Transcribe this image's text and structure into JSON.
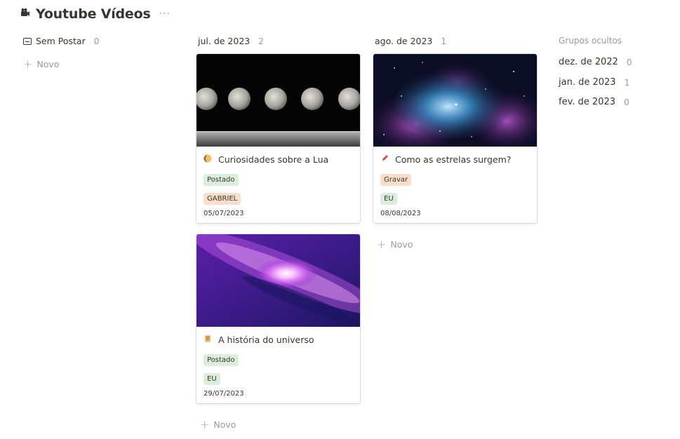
{
  "page": {
    "title": "Youtube Vídeos",
    "icon": "movie-camera-icon",
    "more": "···"
  },
  "columns": [
    {
      "label": "Sem Postar",
      "count": "0",
      "new_label": "Novo"
    },
    {
      "label": "jul. de 2023",
      "count": "2",
      "new_label": "Novo"
    },
    {
      "label": "ago. de 2023",
      "count": "1",
      "new_label": "Novo"
    }
  ],
  "cards": [
    {
      "title": "Curiosidades sobre a Lua",
      "emoji": "moon-icon",
      "status": "Postado",
      "status_color": "#dbeddb",
      "owner": "GABRIEL",
      "owner_color": "#fadec9",
      "date": "05/07/2023"
    },
    {
      "title": "A história do universo",
      "emoji": "scroll-icon",
      "status": "Postado",
      "status_color": "#dbeddb",
      "owner": "EU",
      "owner_color": "#dbeddb",
      "date": "29/07/2023"
    },
    {
      "title": "Como as estrelas surgem?",
      "emoji": "crayon-icon",
      "status": "Gravar",
      "status_color": "#fadec9",
      "owner": "EU",
      "owner_color": "#dbeddb",
      "date": "08/08/2023"
    }
  ],
  "hidden": {
    "label": "Grupos ocultos",
    "groups": [
      {
        "label": "dez. de 2022",
        "count": "0"
      },
      {
        "label": "jan. de 2023",
        "count": "1"
      },
      {
        "label": "fev. de 2023",
        "count": "0"
      }
    ]
  }
}
